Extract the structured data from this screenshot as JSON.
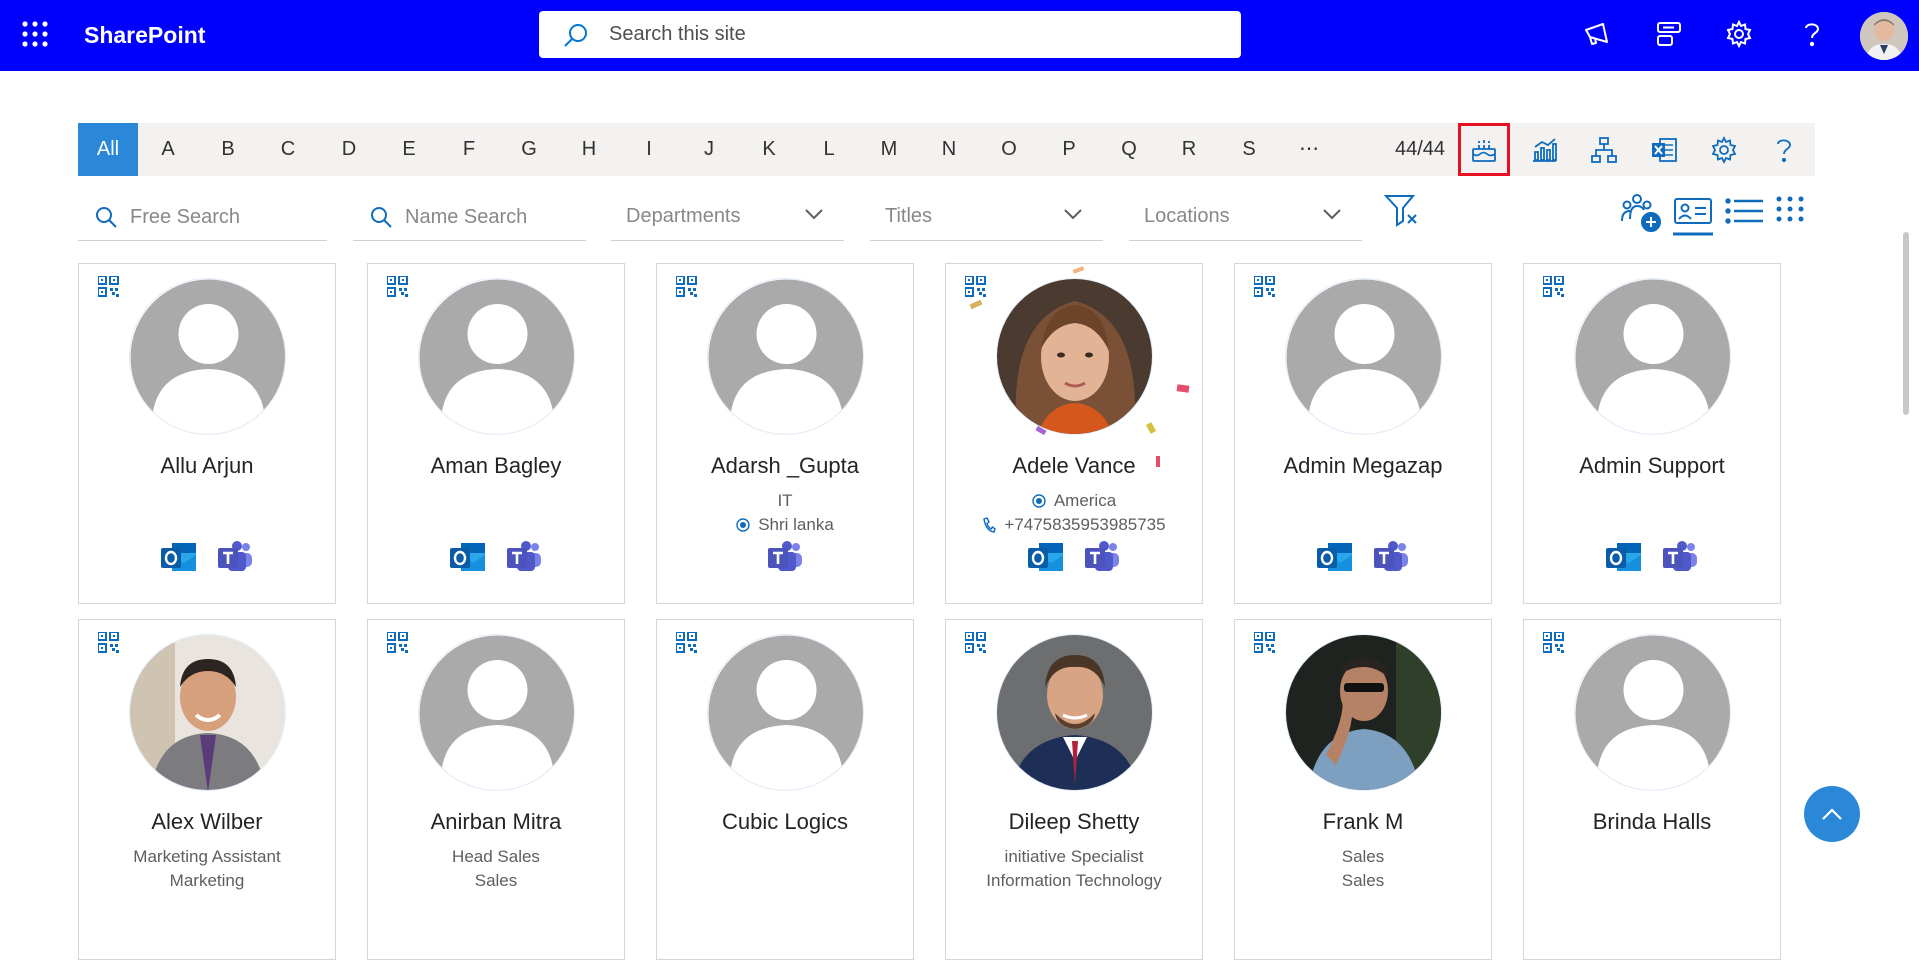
{
  "suitebar": {
    "app_name": "SharePoint",
    "search_placeholder": "Search this site",
    "icons": [
      "megaphone-icon",
      "chat-icon",
      "gear-icon",
      "help-icon"
    ]
  },
  "alphabet": {
    "letters": [
      "All",
      "A",
      "B",
      "C",
      "D",
      "E",
      "F",
      "G",
      "H",
      "I",
      "J",
      "K",
      "L",
      "M",
      "N",
      "O",
      "P",
      "Q",
      "R",
      "S",
      "⋯"
    ],
    "active": "All",
    "count": "44/44",
    "tools": [
      "birthday-cake-icon",
      "analytics-icon",
      "org-chart-icon",
      "excel-export-icon",
      "settings-icon",
      "help-icon"
    ]
  },
  "filters": {
    "free_search_placeholder": "Free Search",
    "name_search_placeholder": "Name Search",
    "departments": "Departments",
    "titles": "Titles",
    "locations": "Locations"
  },
  "colors": {
    "suitebar": "#0000ff",
    "accent": "#2b88d8",
    "highlight": "#e81123"
  },
  "cards": [
    {
      "name": "Allu Arjun",
      "line1": "",
      "line2": "",
      "apps": [
        "outlook",
        "teams"
      ],
      "photo": "placeholder"
    },
    {
      "name": "Aman Bagley",
      "line1": "",
      "line2": "",
      "apps": [
        "outlook",
        "teams"
      ],
      "photo": "placeholder"
    },
    {
      "name": "Adarsh _Gupta",
      "line1": "IT",
      "line2": "Shri lanka",
      "apps": [
        "teams"
      ],
      "photo": "placeholder"
    },
    {
      "name": "Adele Vance",
      "line1": "America",
      "line2": "+7475835953985735",
      "apps": [
        "outlook",
        "teams"
      ],
      "photo": "woman"
    },
    {
      "name": "Admin Megazap",
      "line1": "",
      "line2": "",
      "apps": [
        "outlook",
        "teams"
      ],
      "photo": "placeholder"
    },
    {
      "name": "Admin Support",
      "line1": "",
      "line2": "",
      "apps": [
        "outlook",
        "teams"
      ],
      "photo": "placeholder"
    },
    {
      "name": "Alex Wilber",
      "line1": "Marketing Assistant",
      "line2": "Marketing",
      "apps": [],
      "photo": "man-office"
    },
    {
      "name": "Anirban Mitra",
      "line1": "Head Sales",
      "line2": "Sales",
      "apps": [],
      "photo": "placeholder"
    },
    {
      "name": "Cubic Logics",
      "line1": "",
      "line2": "",
      "apps": [],
      "photo": "placeholder"
    },
    {
      "name": "Dileep Shetty",
      "line1": "initiative Specialist",
      "line2": "Information Technology",
      "apps": [],
      "photo": "man-suit"
    },
    {
      "name": "Frank M",
      "line1": "Sales",
      "line2": "Sales",
      "apps": [],
      "photo": "man-dark"
    },
    {
      "name": "Brinda Halls",
      "line1": "",
      "line2": "",
      "apps": [],
      "photo": "placeholder"
    }
  ]
}
